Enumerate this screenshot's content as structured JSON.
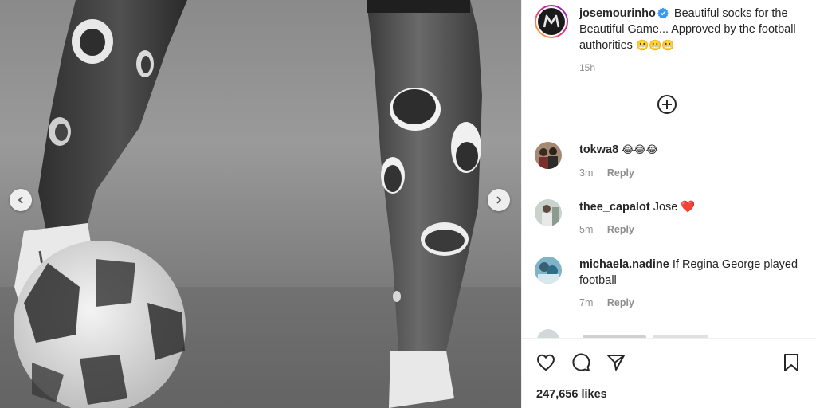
{
  "post": {
    "username": "josemourinho",
    "caption_text": "Beautiful socks for the Beautiful Game... Approved by the football authorities",
    "caption_emoji": "😬😬😬",
    "time_ago": "15h",
    "likes": "247,656 likes"
  },
  "comments": [
    {
      "username": "tokwa8",
      "text": "😂😂😂",
      "time_ago": "3m",
      "reply_label": "Reply"
    },
    {
      "username": "thee_capalot",
      "text": "Jose ❤️",
      "time_ago": "5m",
      "reply_label": "Reply"
    },
    {
      "username": "michaela.nadine",
      "text": "If Regina George played football",
      "time_ago": "7m",
      "reply_label": "Reply"
    }
  ],
  "icons": {
    "verified": "verified-badge-icon",
    "load_more": "plus-circle-icon",
    "like": "heart-icon",
    "comment": "comment-bubble-icon",
    "share": "paper-plane-icon",
    "save": "bookmark-icon",
    "prev": "chevron-left-icon",
    "next": "chevron-right-icon"
  },
  "colors": {
    "verified_blue": "#3897f0",
    "text_primary": "#262626",
    "text_secondary": "#8e8e8e",
    "heart_red": "#ed4956"
  }
}
